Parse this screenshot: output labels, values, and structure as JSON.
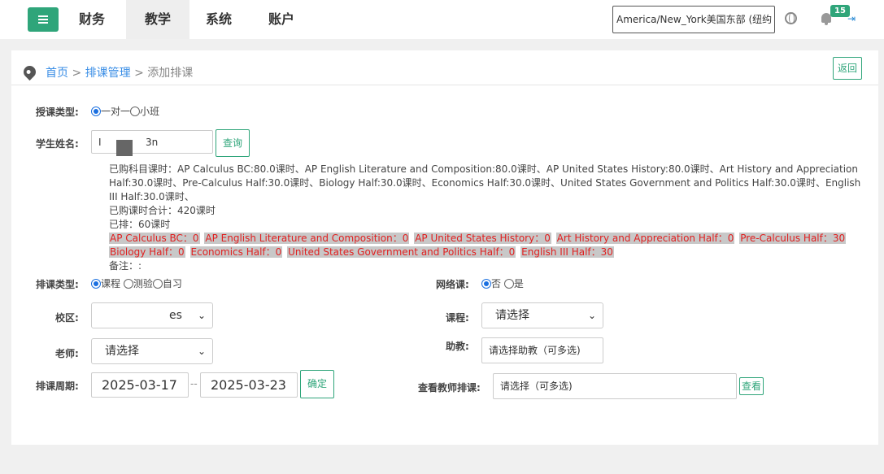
{
  "nav": {
    "items": [
      {
        "label": "财务",
        "active": false
      },
      {
        "label": "教学",
        "active": true
      },
      {
        "label": "系统",
        "active": false
      },
      {
        "label": "账户",
        "active": false
      }
    ],
    "timezone": "America/New_York美国东部 (纽约",
    "notification_count": "15"
  },
  "breadcrumb": {
    "home": "首页",
    "sep1": " > ",
    "section": "排课管理",
    "sep2": " > ",
    "current": "添加排课",
    "back_label": "返回"
  },
  "form": {
    "teach_type_label": "授课类型:",
    "teach_type_options": [
      "一对一",
      "小班"
    ],
    "student_label": "学生姓名:",
    "student_value_start": "I",
    "student_value_end": "3n",
    "query_label": "查询",
    "purchased": "已购科目课时：AP Calculus BC:80.0课时、AP English Literature and Composition:80.0课时、AP United States History:80.0课时、Art History and Appreciation Half:30.0课时、Pre-Calculus Half:30.0课时、Biology Half:30.0课时、Economics Half:30.0课时、United States Government and Politics Half:30.0课时、English III Half:30.0课时、",
    "total": "已购课时合计：420课时",
    "scheduled": "已排：60课时",
    "subject_hours": [
      "AP Calculus BC：0",
      "AP English Literature and Composition：0",
      "AP United States History：0",
      "Art History and Appreciation Half：0",
      "Pre-Calculus Half：30",
      "Biology Half：0",
      "Economics Half：0",
      "United States Government and Politics Half：0",
      "English III Half：30"
    ],
    "note": "备注：:",
    "schedule_type_label": "排课类型:",
    "schedule_type_options": [
      "课程",
      "测验",
      "自习"
    ],
    "online_label": "网络课:",
    "online_options": [
      "否",
      "是"
    ],
    "campus_label": "校区:",
    "campus_value": "es",
    "course_label": "课程:",
    "course_value": "请选择",
    "teacher_label": "老师:",
    "teacher_value": "请选择",
    "ta_label": "助教:",
    "ta_placeholder": "请选择助教（可多选)",
    "period_label": "排课周期:",
    "start_date": "2025-03-17",
    "date_sep": "--",
    "end_date": "2025-03-23",
    "confirm_label": "确定",
    "view_teacher_label": "查看教师排课:",
    "view_teacher_placeholder": "请选择（可多选)",
    "view_label": "查看"
  }
}
